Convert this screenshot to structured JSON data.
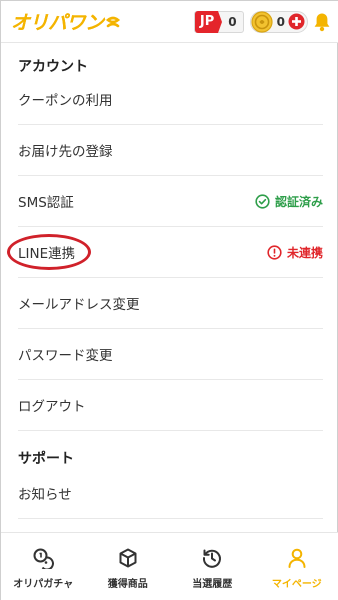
{
  "header": {
    "logo_text": "オリパワン",
    "jp_label": "JP",
    "jp_count": "0",
    "coin_count": "0",
    "icons": [
      "coin-icon",
      "add-icon",
      "bell-icon"
    ]
  },
  "account": {
    "title": "アカウント",
    "items": [
      {
        "label": "クーポンの利用"
      },
      {
        "label": "お届け先の登録"
      },
      {
        "label": "SMS認証",
        "status": "認証済み",
        "status_type": "ok"
      },
      {
        "label": "LINE連携",
        "status": "未連携",
        "status_type": "ng"
      },
      {
        "label": "メールアドレス変更"
      },
      {
        "label": "パスワード変更"
      },
      {
        "label": "ログアウト"
      }
    ]
  },
  "support": {
    "title": "サポート",
    "items": [
      {
        "label": "お知らせ"
      }
    ]
  },
  "bottom_nav": {
    "items": [
      {
        "label": "オリパガチャ",
        "icon": "gacha-icon"
      },
      {
        "label": "獲得商品",
        "icon": "box-icon"
      },
      {
        "label": "当選履歴",
        "icon": "history-icon"
      },
      {
        "label": "マイページ",
        "icon": "person-icon",
        "active": true
      }
    ]
  },
  "colors": {
    "brand": "#f4b400",
    "ok": "#2e9e4a",
    "ng": "#e0262b",
    "highlight": "#d0212a"
  }
}
